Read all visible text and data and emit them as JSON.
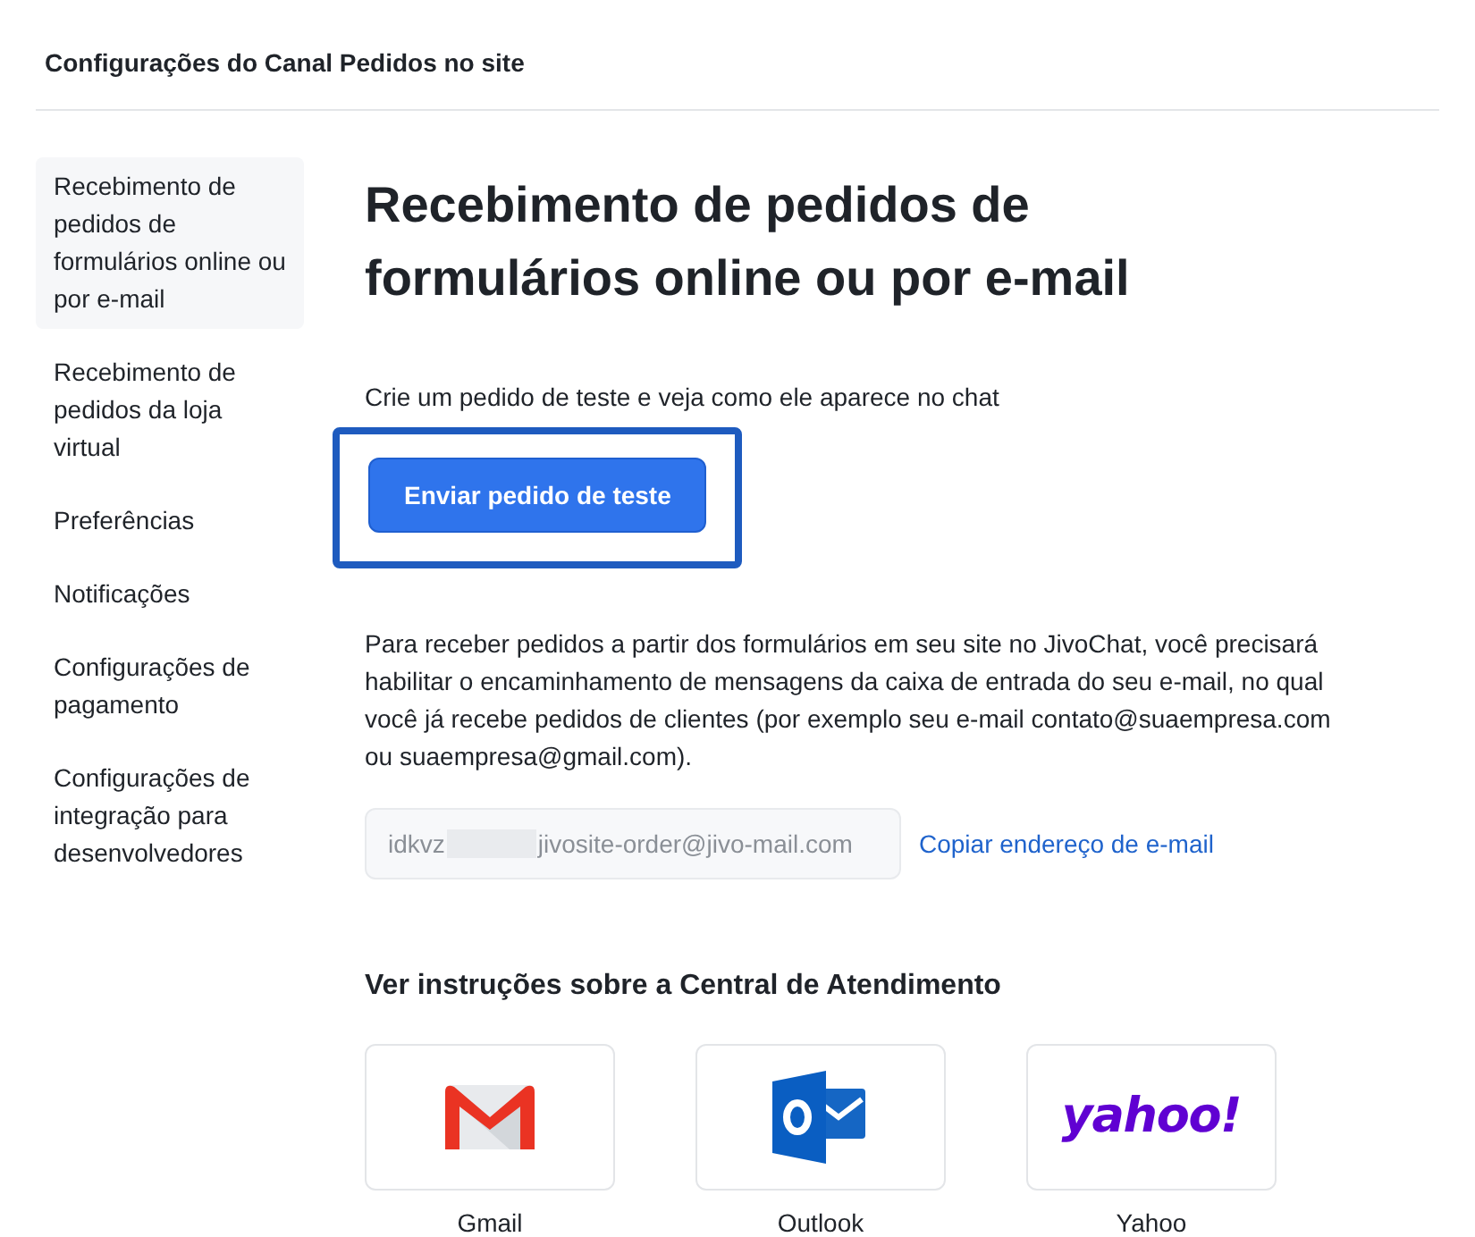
{
  "header": {
    "title": "Configurações do Canal Pedidos no site"
  },
  "sidebar": {
    "items": [
      {
        "label": "Recebimento de pedidos de formulários online ou por e-mail",
        "selected": true
      },
      {
        "label": "Recebimento de pedidos da loja virtual",
        "selected": false
      },
      {
        "label": "Preferências",
        "selected": false
      },
      {
        "label": "Notificações",
        "selected": false
      },
      {
        "label": "Configurações de pagamento",
        "selected": false
      },
      {
        "label": "Configurações de integração para desenvolvedores",
        "selected": false
      }
    ]
  },
  "main": {
    "title": "Recebimento de pedidos de formulários online ou por e-mail",
    "test_hint": "Crie um pedido de teste e veja como ele aparece no chat",
    "test_button": {
      "label": "Enviar pedido de teste",
      "highlighted": true
    },
    "description": "Para receber pedidos a partir dos formulários em seu site no JivoChat, você precisará habilitar o encaminhamento de mensagens da caixa de entrada do seu e-mail, no qual você já recebe pedidos de clientes (por exemplo seu e-mail contato@suaempresa.com ou suaempresa@gmail.com).",
    "email_field": {
      "value_start": "idkvz",
      "value_end": "jivosite-order@jivo-mail.com",
      "redacted": true
    },
    "copy_link": "Copiar endereço de e-mail",
    "instructions_title": "Ver instruções sobre a Central de Atendimento",
    "providers": [
      {
        "kind": "gmail",
        "label": "Gmail"
      },
      {
        "kind": "outlook",
        "label": "Outlook"
      },
      {
        "kind": "yahoo",
        "label": "Yahoo",
        "logo_text": "yahoo!"
      }
    ]
  }
}
